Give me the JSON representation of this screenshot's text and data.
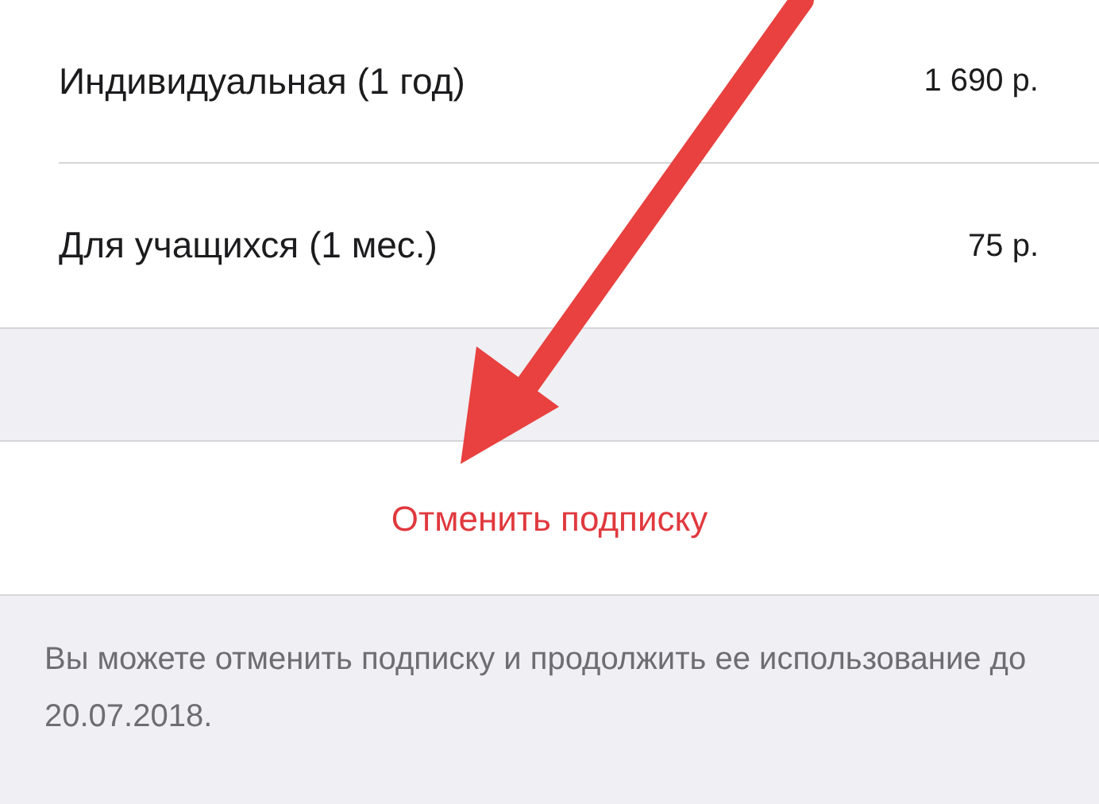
{
  "plans": [
    {
      "name": "Индивидуальная (1 год)",
      "price": "1 690 р."
    },
    {
      "name": "Для учащихся (1 мес.)",
      "price": "75 р."
    }
  ],
  "cancel_button": "Отменить подписку",
  "footer_note": "Вы можете отменить подписку и продолжить ее использование до 20.07.2018."
}
